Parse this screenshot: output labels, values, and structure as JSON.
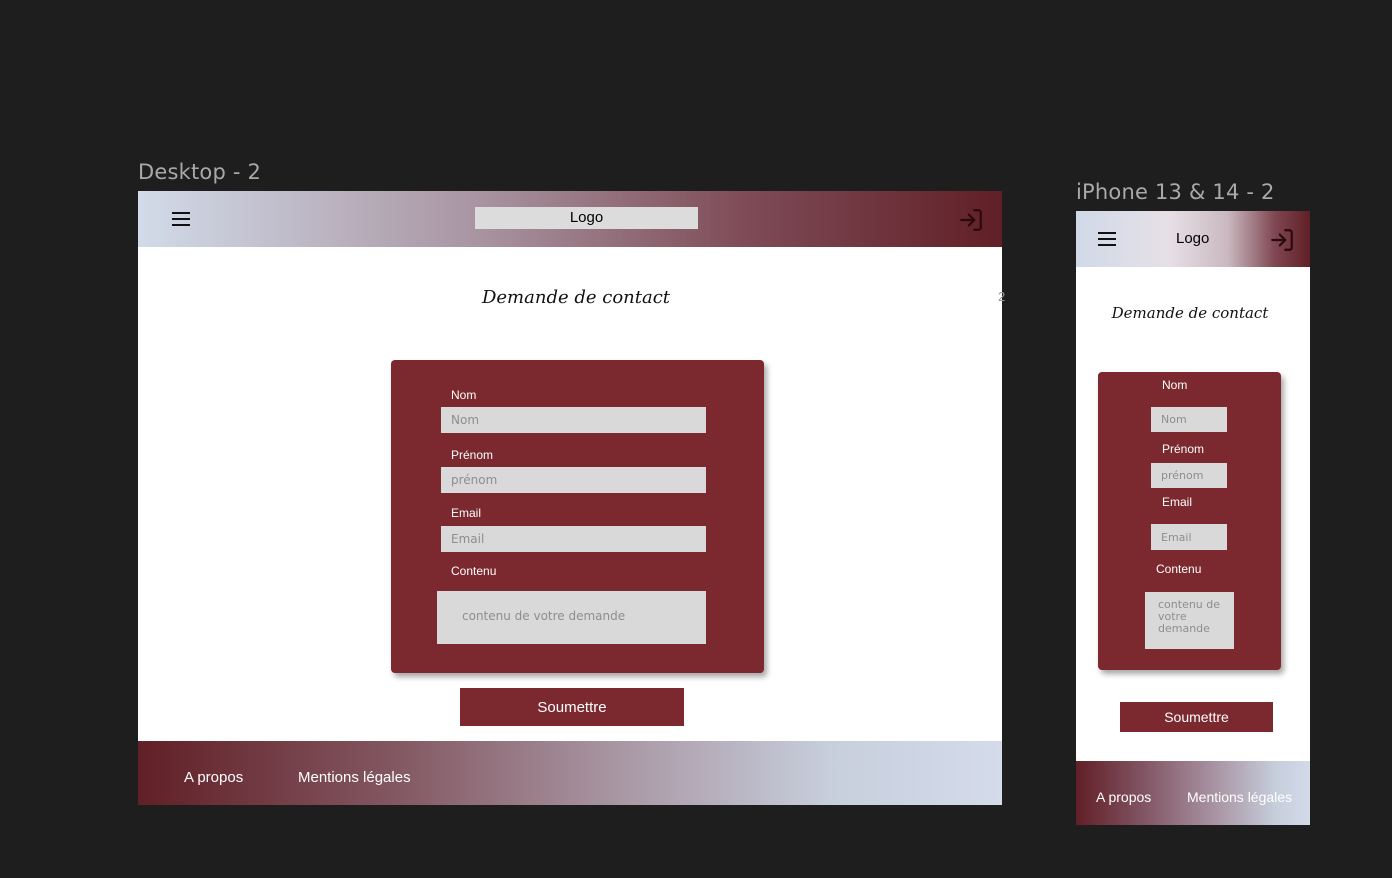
{
  "desktop": {
    "frame_label": "Desktop - 2",
    "header": {
      "logo": "Logo"
    },
    "title": "Demande de contact",
    "form": {
      "nom_label": "Nom",
      "nom_placeholder": "Nom",
      "prenom_label": "Prénom",
      "prenom_placeholder": "prénom",
      "email_label": "Email",
      "email_placeholder": "Email",
      "contenu_label": "Contenu",
      "contenu_placeholder": "contenu de votre demande"
    },
    "submit_label": "Soumettre",
    "footer": {
      "about": "A propos",
      "legal": "Mentions légales"
    }
  },
  "mobile": {
    "frame_label": "iPhone 13 & 14 - 2",
    "header": {
      "logo": "Logo"
    },
    "title": "Demande de contact",
    "form": {
      "nom_label": "Nom",
      "nom_placeholder": "Nom",
      "prenom_label": "Prénom",
      "prenom_placeholder": "prénom",
      "email_label": "Email",
      "email_placeholder": "Email",
      "contenu_label": "Contenu",
      "contenu_placeholder": "contenu de votre demande"
    },
    "submit_label": "Soumettre",
    "footer": {
      "about": "A propos",
      "legal": "Mentions légales"
    }
  },
  "stray_glyph": "2",
  "colors": {
    "canvas": "#1e1e1e",
    "brand": "#7b292e",
    "header_dark": "#611f26",
    "header_light": "#d2dbe9",
    "input_bg": "#d9d9d9"
  },
  "icons": {
    "menu": "hamburger-menu-icon",
    "login": "login-icon"
  }
}
